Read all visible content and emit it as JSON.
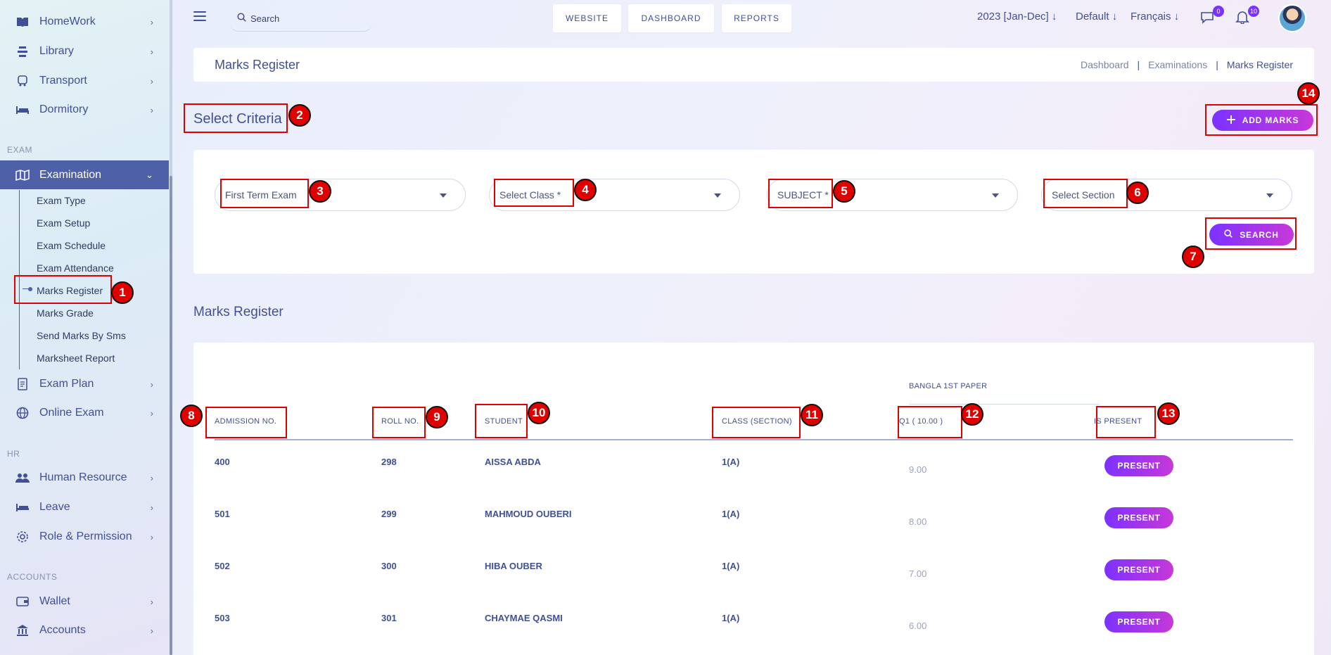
{
  "sidebar": {
    "items_top": [
      {
        "label": "HomeWork",
        "icon": "book-icon"
      },
      {
        "label": "Library",
        "icon": "library-icon"
      },
      {
        "label": "Transport",
        "icon": "bus-icon"
      },
      {
        "label": "Dormitory",
        "icon": "bed-icon"
      }
    ],
    "section_exam": "EXAM",
    "examination_label": "Examination",
    "sub_items": [
      "Exam Type",
      "Exam Setup",
      "Exam Schedule",
      "Exam Attendance",
      "Marks Register",
      "Marks Grade",
      "Send Marks By Sms",
      "Marksheet Report"
    ],
    "exam_plan": "Exam Plan",
    "online_exam": "Online Exam",
    "section_hr": "HR",
    "hr_items": [
      "Human Resource",
      "Leave",
      "Role & Permission"
    ],
    "section_accounts": "ACCOUNTS",
    "account_items": [
      "Wallet",
      "Accounts"
    ]
  },
  "topbar": {
    "search_placeholder": "Search",
    "buttons": [
      "WEBSITE",
      "DASHBOARD",
      "REPORTS"
    ],
    "session": "2023 [Jan-Dec]",
    "style": "Default",
    "language": "Français",
    "messages_count": "0",
    "notifications_count": "10"
  },
  "header": {
    "title": "Marks Register",
    "breadcrumb": [
      "Dashboard",
      "Examinations",
      "Marks Register"
    ],
    "sep": "|"
  },
  "criteria": {
    "title": "Select Criteria",
    "add_marks": "ADD MARKS",
    "exam": "First Term Exam",
    "class": "Select Class *",
    "subject": "SUBJECT *",
    "section": "Select Section",
    "search": "SEARCH"
  },
  "register": {
    "title": "Marks Register",
    "subject_group": "BANGLA 1ST PAPER",
    "headers": [
      "ADMISSION NO.",
      "ROLL NO.",
      "STUDENT",
      "CLASS (SECTION)",
      "Q1 ( 10.00 )",
      "IS PRESENT"
    ],
    "rows": [
      {
        "admission": "400",
        "roll": "298",
        "student": "AISSA ABDA",
        "class": "1(A)",
        "mark": "9.00",
        "status": "PRESENT"
      },
      {
        "admission": "501",
        "roll": "299",
        "student": "MAHMOUD OUBERI",
        "class": "1(A)",
        "mark": "8.00",
        "status": "PRESENT"
      },
      {
        "admission": "502",
        "roll": "300",
        "student": "HIBA OUBER",
        "class": "1(A)",
        "mark": "7.00",
        "status": "PRESENT"
      },
      {
        "admission": "503",
        "roll": "301",
        "student": "CHAYMAE QASMI",
        "class": "1(A)",
        "mark": "6.00",
        "status": "PRESENT"
      }
    ]
  },
  "annotations": [
    "1",
    "2",
    "3",
    "4",
    "5",
    "6",
    "7",
    "8",
    "9",
    "10",
    "11",
    "12",
    "13",
    "14"
  ],
  "colors": {
    "accent": "#7c32ff",
    "accent2": "#c738d8",
    "primary": "#415094",
    "annotation": "#e00000"
  }
}
